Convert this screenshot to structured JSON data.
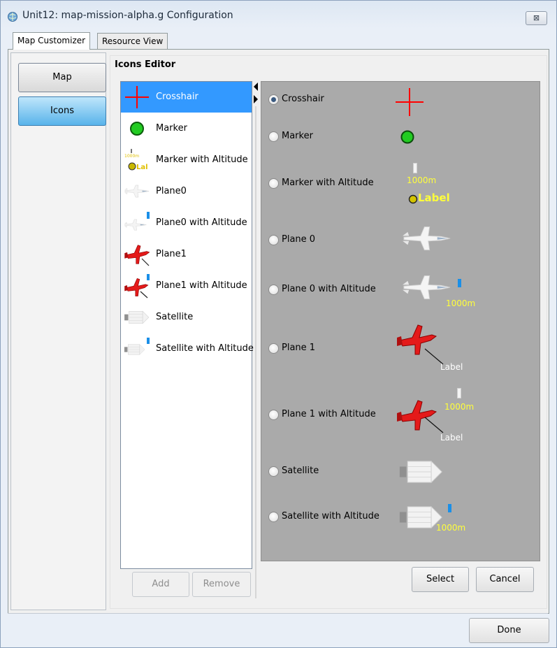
{
  "window": {
    "title": "Unit12: map-mission-alpha.g Configuration",
    "close_glyph": "⊠"
  },
  "tabs": [
    {
      "label": "Map Customizer"
    },
    {
      "label": "Resource View"
    }
  ],
  "sidebar": {
    "items": [
      {
        "label": "Map"
      },
      {
        "label": "Icons"
      }
    ]
  },
  "editor": {
    "title": "Icons Editor",
    "list": [
      {
        "label": "Crosshair",
        "icon": "crosshair-icon"
      },
      {
        "label": "Marker",
        "icon": "marker-icon"
      },
      {
        "label": "Marker with Altitude",
        "icon": "marker-altitude-icon",
        "tiny_alt": "1000m",
        "tiny_label": "Lal"
      },
      {
        "label": "Plane0",
        "icon": "plane0-icon"
      },
      {
        "label": "Plane0 with Altitude",
        "icon": "plane0-altitude-icon"
      },
      {
        "label": "Plane1",
        "icon": "plane1-icon"
      },
      {
        "label": "Plane1 with Altitude",
        "icon": "plane1-altitude-icon"
      },
      {
        "label": "Satellite",
        "icon": "satellite-icon"
      },
      {
        "label": "Satellite with Altitude",
        "icon": "satellite-altitude-icon"
      }
    ],
    "add_label": "Add",
    "remove_label": "Remove",
    "preview": {
      "options": [
        {
          "label": "Crosshair",
          "selected": true
        },
        {
          "label": "Marker",
          "selected": false
        },
        {
          "label": "Marker with Altitude",
          "selected": false
        },
        {
          "label": "Plane 0",
          "selected": false
        },
        {
          "label": "Plane 0 with Altitude",
          "selected": false
        },
        {
          "label": "Plane 1",
          "selected": false
        },
        {
          "label": "Plane 1 with Altitude",
          "selected": false
        },
        {
          "label": "Satellite",
          "selected": false
        },
        {
          "label": "Satellite with Altitude",
          "selected": false
        }
      ],
      "altitude_text": "1000m",
      "label_text": "Label"
    },
    "select_label": "Select",
    "cancel_label": "Cancel"
  },
  "footer": {
    "done_label": "Done"
  },
  "colors": {
    "selection": "#3399ff",
    "preview_bg": "#aaaaaa",
    "crosshair": "#ff0000",
    "altitude_text": "#ffff3a",
    "marker_green": "#22cc22"
  }
}
